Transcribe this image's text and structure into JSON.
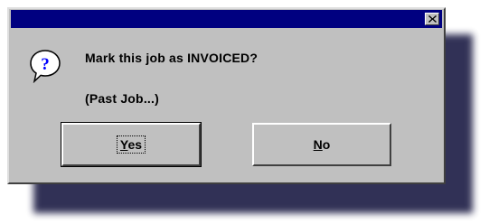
{
  "dialog": {
    "title": "",
    "close_icon": "close-x-icon",
    "message_icon": "question-icon",
    "message": "Mark this job as INVOICED?",
    "submessage": "(Past Job...)"
  },
  "buttons": {
    "yes": {
      "mnemonic": "Y",
      "rest": "es"
    },
    "no": {
      "mnemonic": "N",
      "rest": "o"
    }
  },
  "colors": {
    "title_bar": "#000080",
    "dialog_face": "#c0c0c0",
    "shadow": "#26264d",
    "icon_bubble": "#ffffff",
    "icon_glyph": "#0000ff"
  }
}
